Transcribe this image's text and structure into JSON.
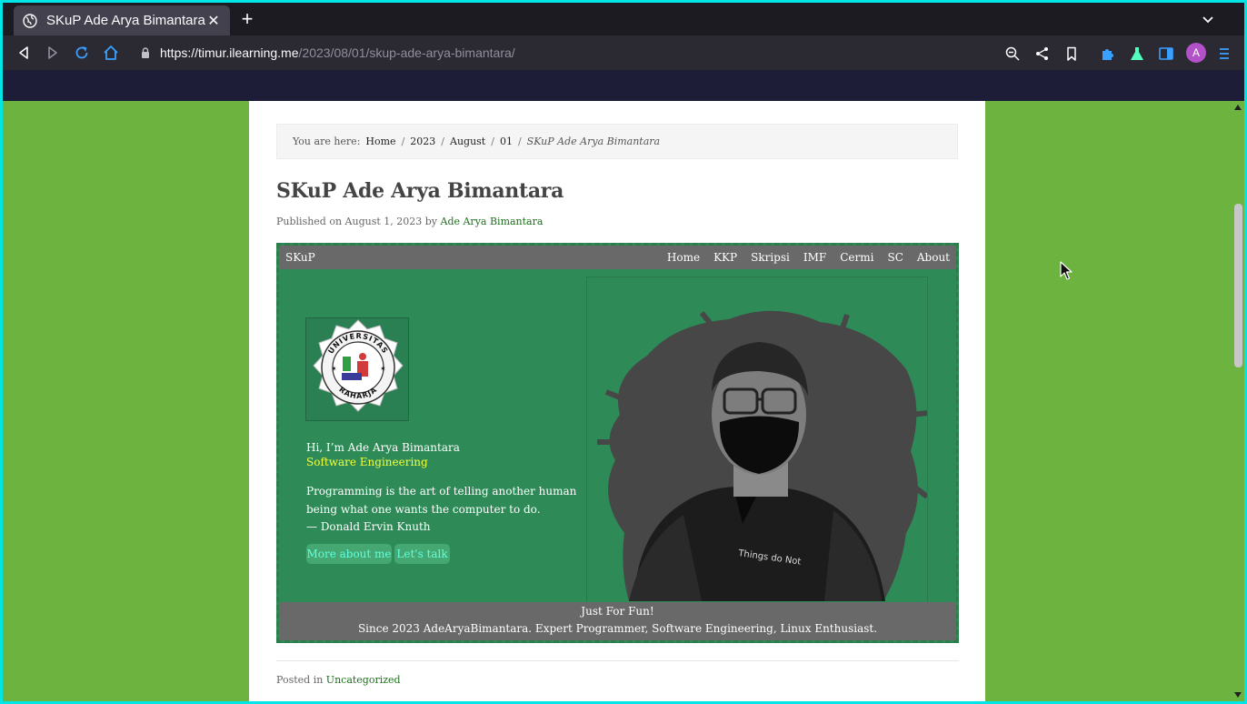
{
  "browser": {
    "tab_title": "SKuP Ade Arya Bimantara",
    "url_host": "https://timur.ilearning.me",
    "url_path": "/2023/08/01/skup-ade-arya-bimantara/",
    "avatar_letter": "A"
  },
  "breadcrumb": {
    "label": "You are here:",
    "items": [
      "Home",
      "2023",
      "August",
      "01"
    ],
    "current": "SKuP Ade Arya Bimantara"
  },
  "post": {
    "title": "SKuP Ade Arya Bimantara",
    "published_prefix": "Published on August 1, 2023 by",
    "author": "Ade Arya Bimantara",
    "posted_in_label": "Posted in",
    "category": "Uncategorized"
  },
  "embed": {
    "brand": "SKuP",
    "nav": [
      "Home",
      "KKP",
      "Skripsi",
      "IMF",
      "Cermi",
      "SC",
      "About"
    ],
    "greeting": "Hi, I’m Ade Arya Bimantara",
    "role": "Software Engineering",
    "quote_line1": "Programming is the art of telling another human",
    "quote_line2": "being what one wants the computer to do.",
    "quote_author": "— Donald Ervin Knuth",
    "button_more": "More about me",
    "button_talk": "Let's talk",
    "logo_text_top": "UNIVERSITAS",
    "logo_text_bottom": "RAHARJA",
    "shirt_text": "Things do Not",
    "footer_line1": "Just For Fun!",
    "footer_line2": "Since 2023 AdeAryaBimantara. Expert Programmer, Software Engineering, Linux Enthusiast."
  },
  "colors": {
    "page_bg": "#6db33f",
    "embed_bg": "#2e8b57",
    "embed_bar": "#696969",
    "role": "#f5ff3a",
    "button_text": "#5fffe0",
    "link": "#1f6e1f"
  }
}
